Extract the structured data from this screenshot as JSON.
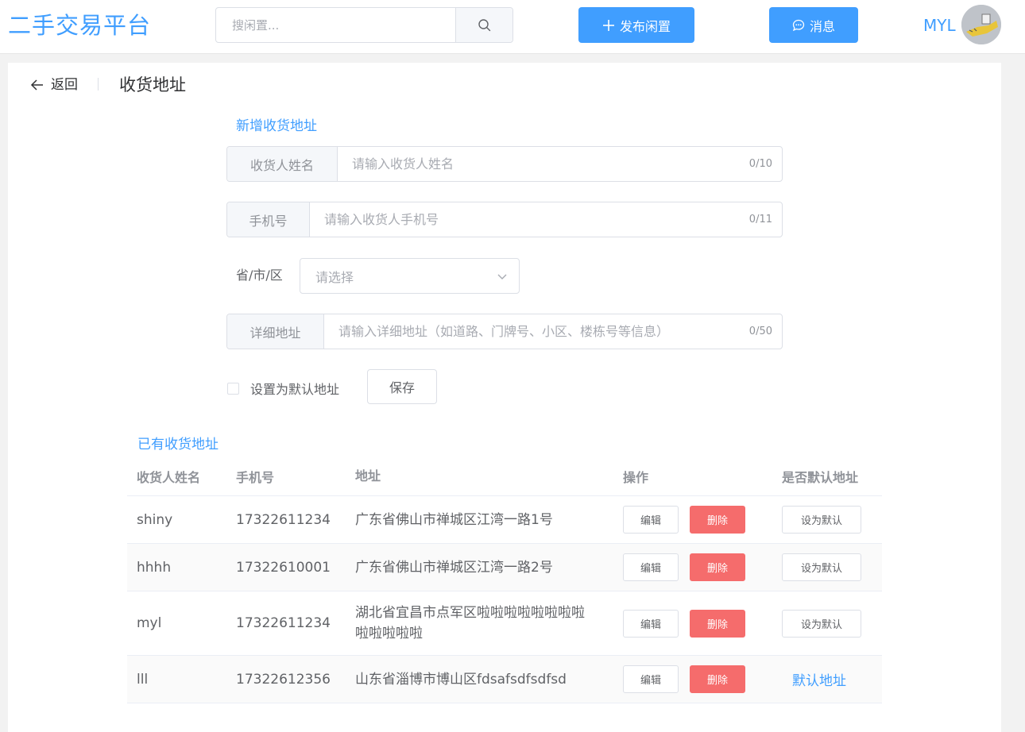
{
  "header": {
    "logo": "二手交易平台",
    "search_placeholder": "搜闲置...",
    "publish_label": "发布闲置",
    "message_label": "消息",
    "user_name": "MYL"
  },
  "page": {
    "back_label": "返回",
    "title": "收货地址"
  },
  "form": {
    "section_title": "新增收货地址",
    "name_label": "收货人姓名",
    "name_placeholder": "请输入收货人姓名",
    "name_count": "0/10",
    "phone_label": "手机号",
    "phone_placeholder": "请输入收货人手机号",
    "phone_count": "0/11",
    "region_label": "省/市/区",
    "region_placeholder": "请选择",
    "detail_label": "详细地址",
    "detail_placeholder": "请输入详细地址（如道路、门牌号、小区、楼栋号等信息）",
    "detail_count": "0/50",
    "default_label": "设置为默认地址",
    "save_label": "保存"
  },
  "list": {
    "section_title": "已有收货地址",
    "headers": [
      "收货人姓名",
      "手机号",
      "地址",
      "操作",
      "是否默认地址"
    ],
    "edit_label": "编辑",
    "delete_label": "删除",
    "set_default_label": "设为默认",
    "is_default_label": "默认地址",
    "rows": [
      {
        "name": "shiny",
        "phone": "17322611234",
        "address": "广东省佛山市禅城区江湾一路1号",
        "is_default": false
      },
      {
        "name": "hhhh",
        "phone": "17322610001",
        "address": "广东省佛山市禅城区江湾一路2号",
        "is_default": false
      },
      {
        "name": "myl",
        "phone": "17322611234",
        "address": "湖北省宜昌市点军区啦啦啦啦啦啦啦啦啦啦啦啦啦",
        "is_default": false
      },
      {
        "name": "lll",
        "phone": "17322612356",
        "address": "山东省淄博市博山区fdsafsdfsdfsd",
        "is_default": true
      }
    ]
  },
  "colors": {
    "primary": "#409eff",
    "danger": "#f56c6c"
  }
}
